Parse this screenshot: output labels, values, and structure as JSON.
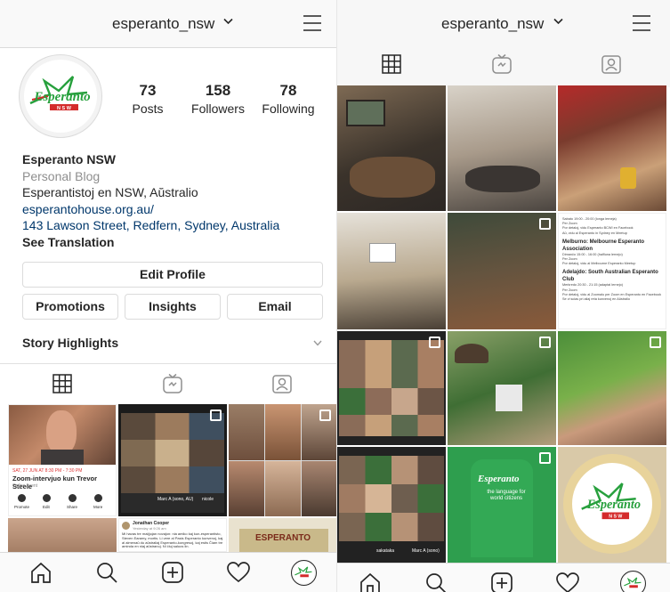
{
  "left": {
    "username": "esperanto_nsw",
    "stats": [
      {
        "value": "73",
        "label": "Posts"
      },
      {
        "value": "158",
        "label": "Followers"
      },
      {
        "value": "78",
        "label": "Following"
      }
    ],
    "bio": {
      "name": "Esperanto NSW",
      "category": "Personal Blog",
      "line": "Esperantistoj en NSW, Aŭstralio",
      "website": "esperantohouse.org.au/",
      "address": "143 Lawson Street, Redfern, Sydney, Australia",
      "translate": "See Translation"
    },
    "edit_profile": "Edit Profile",
    "buttons": [
      "Promotions",
      "Insights",
      "Email"
    ],
    "story_highlights": "Story Highlights",
    "posts": {
      "event_date": "SAT, 27 JUN AT 8:30 PM - 7:30 PM",
      "event_title": "Zoom-intervjuo kun Trevor Steele",
      "event_sub": "Online event",
      "event_actions": [
        "Promote",
        "Edit",
        "Share",
        "More"
      ],
      "zoom_names": [
        "Marc A (sono, AU)",
        "nicole"
      ],
      "fb_name": "Jonathan Cooper",
      "fb_time": "Yesterday at 9:26 am",
      "fb_text": "Mi havas tre malĝojan novaĵon: nia amiko kaj kun-esperantisto, Steven Earamy, mortis. Li vere al Pasis Esperanto kunvenoj, kaj al almenaŭ du aŭstraliaj Esperanto-kongresoj, kaj estis Ĉiam tre aminda en niaj aŭstranoj. Ni ĉiuj saluos lin.",
      "book_text": "ESPERANTO"
    }
  },
  "right": {
    "username": "esperanto_nsw",
    "club_lines": [
      "Sabato 19:00 - 20:00 (longa lerneja)",
      "Per Zoom",
      "Por detaloj, vidu Esperanto BCWI en Facebook",
      "Aŭ, vidu al Esperanto in Sydney en Meetup",
      "Melburno: Melbourne Esperanto Association",
      "Dimanĉo 15:00 - 16:00 (halfluna lernejo)",
      "Per Zoom",
      "Por detaloj, vidu al Melbourne Esperanto Meetup",
      "Adelajdo: South Australian Esperanto Club",
      "Merkredo 20:30 - 21:15 (adaptal lernejo)",
      "Per Zoom",
      "Por detaloj, vidu al Zoomalu per Zoom en Esperanto en Facebook",
      "Se vi scias pri aliaj reta kunvenoj en Aŭstralio"
    ],
    "zoom_names": [
      "sakataka",
      "Marc A (sono)"
    ],
    "shirt_line1": "Esperanto",
    "shirt_line2": "the language for world citizens"
  },
  "logo": {
    "script": "Esperanto",
    "ribbon": "N S W"
  },
  "colors": {
    "link": "#00376b",
    "muted": "#8e8e8e",
    "logo_green": "#27a03d",
    "logo_red": "#d42b2b",
    "shirt_green": "#2e9e4e"
  }
}
